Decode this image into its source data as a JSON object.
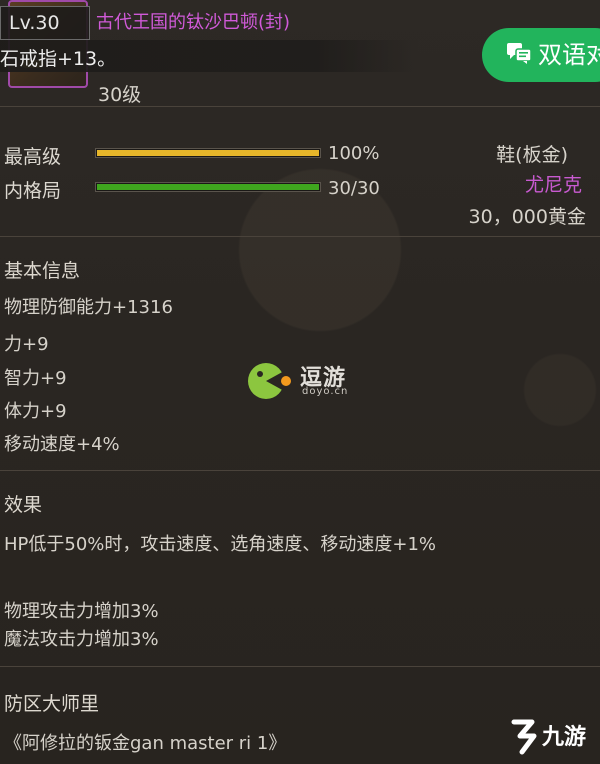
{
  "header": {
    "level_badge": "Lv.30",
    "item_name": "古代王国的钛沙巴顿(封)",
    "subtitle": "石戒指+13。",
    "level_text": "30级"
  },
  "translate_button": {
    "label": "双语对"
  },
  "stats": [
    {
      "label": "最高级",
      "value": "100%",
      "fill_fraction": 1.0,
      "color": "#e7b62a"
    },
    {
      "label": "内格局",
      "value": "30/30",
      "fill_fraction": 1.0,
      "color": "#3fa61e"
    }
  ],
  "item_info": {
    "type": "鞋(板金)",
    "set": "尤尼克",
    "price": "30，000黄金"
  },
  "basic_info": {
    "title": "基本信息",
    "lines": [
      "物理防御能力+1316",
      "力+9",
      "智力+9",
      "体力+9",
      "移动速度+4%"
    ]
  },
  "effects": {
    "title": "效果",
    "lines": [
      "HP低于50%时，攻击速度、选角速度、移动速度+1%",
      "物理攻击力增加3%",
      "魔法攻击力增加3%"
    ]
  },
  "lore": {
    "title": "防区大师里",
    "text": "《阿修拉的钣金gan master ri 1》"
  },
  "watermarks": {
    "center_name": "逗游",
    "center_domain": "doyo.cn",
    "corner_text": "九游"
  },
  "colors": {
    "accent_purple": "#c85ad0",
    "translate_green": "#22b45c"
  }
}
